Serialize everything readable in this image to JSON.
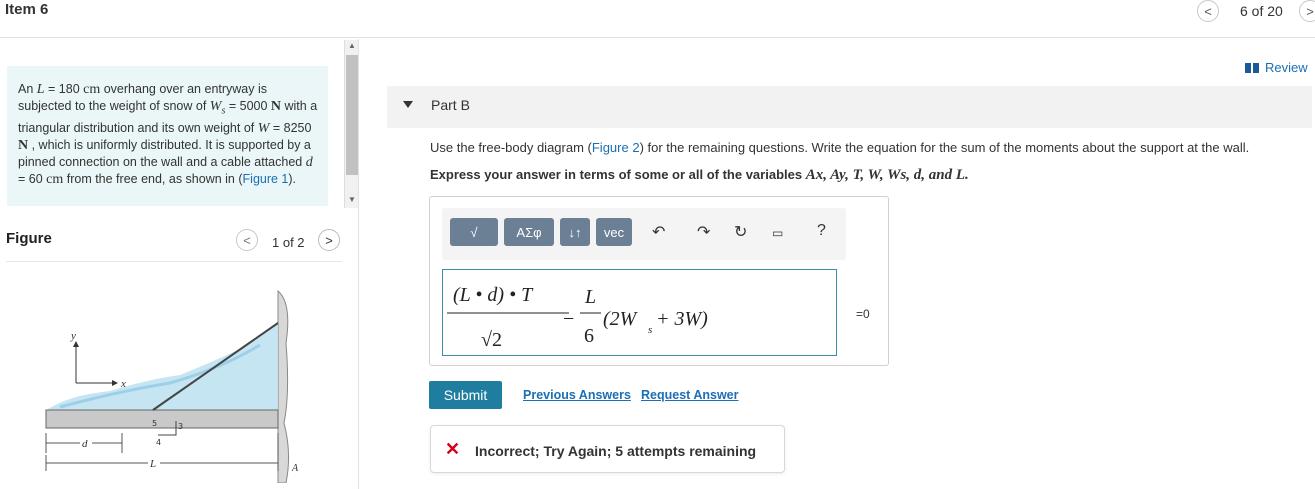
{
  "header": {
    "title": "Item 6",
    "count": "6 of 20"
  },
  "problem": {
    "p1": "An ",
    "L_var": "L",
    "p2": " = 180 ",
    "cm1": "cm",
    "p3": " overhang over an entryway is subjected to the weight of snow of ",
    "Ws_var": "W",
    "Ws_sub": "s",
    "p4": " = 5000 ",
    "N1": "N",
    "p5": " with a triangular distribution and its own weight of ",
    "W_var": "W",
    "p6": " = 8250 ",
    "N2": "N",
    "p7": " , which is uniformly distributed. It is supported by a pinned connection on the wall and a cable attached ",
    "d_var": "d",
    "p8": " = 60 ",
    "cm2": "cm",
    "p9": " from the free end, as shown in (",
    "fig_link": "Figure 1",
    "p10": ")."
  },
  "figure": {
    "label": "Figure",
    "count": "1 of 2",
    "labels": {
      "y": "y",
      "x": "x",
      "five": "5",
      "three": "3",
      "four": "4",
      "A": "A",
      "d": "d",
      "L": "L"
    }
  },
  "review": "Review",
  "part": {
    "title": "Part B"
  },
  "instructions": {
    "text1": "Use the free-body diagram (",
    "link": "Figure 2",
    "text2": ") for the remaining questions. Write the equation for the sum of the moments about the support at the wall."
  },
  "express": {
    "prefix": "Express your answer in terms of some or all of the variables ",
    "vars": "Ax, Ay, T, W, Ws, d, and L."
  },
  "toolbar": {
    "templates": "√",
    "greek": "ΑΣφ",
    "arrows": "↓↑",
    "vec": "vec",
    "help": "?"
  },
  "equation": {
    "num1": "(L • d) • T",
    "den1": "√2",
    "minus": "−",
    "num2": "L",
    "den2": "6",
    "rest": "(2W",
    "sub": "s",
    "rest2": " + 3W)",
    "suffix": "=0"
  },
  "buttons": {
    "submit": "Submit",
    "previous_answers": "Previous Answers",
    "request_answer": "Request Answer"
  },
  "feedback": {
    "icon": "✕",
    "text": "Incorrect; Try Again; 5 attempts remaining"
  },
  "colors": {
    "accent": "#1f7ea0",
    "link": "#1a6fb5",
    "error": "#d0021b",
    "problem_bg": "#eaf6f7"
  }
}
